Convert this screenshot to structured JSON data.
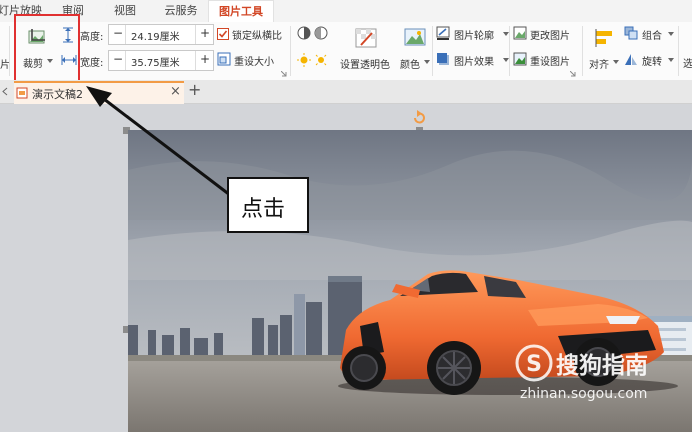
{
  "menu": {
    "tabs": [
      {
        "label": "灯片放映"
      },
      {
        "label": "审阅"
      },
      {
        "label": "视图"
      },
      {
        "label": "云服务"
      },
      {
        "label": "图片工具"
      }
    ]
  },
  "ribbon": {
    "left_edge_label": "片",
    "crop_label": "裁剪",
    "height_label": "高度:",
    "height_value": "24.19厘米",
    "width_label": "宽度:",
    "width_value": "35.75厘米",
    "minus": "−",
    "plus": "+",
    "lock_ratio_label": "锁定纵横比",
    "reset_size_label": "重设大小",
    "transparent_label": "设置透明色",
    "color_label": "颜色",
    "outline_label": "图片轮廓",
    "effect_label": "图片效果",
    "change_picture_label": "更改图片",
    "reset_picture_label": "重设图片",
    "align_label": "对齐",
    "group_label": "组合",
    "rotate_label": "旋转",
    "select_partial": "选"
  },
  "doc_tabs": {
    "active_tab_name": "演示文稿2",
    "close_glyph": "×",
    "add_glyph": "+"
  },
  "annotation": {
    "callout_text": "点击"
  },
  "watermark": {
    "brand": "搜狗指南",
    "url": "zhinan.sogou.com"
  },
  "colors": {
    "accent_tab": "#d24726",
    "highlight_box": "#e03030",
    "car_orange": "#f06a32"
  }
}
